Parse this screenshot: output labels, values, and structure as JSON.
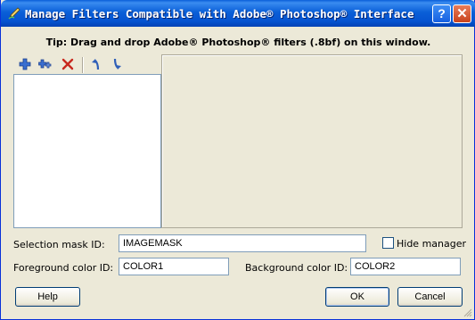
{
  "window": {
    "title": "Manage Filters Compatible with Adobe® Photoshop® Interface",
    "help_glyph": "?",
    "close_glyph": "✕"
  },
  "tip": "Tip: Drag and drop Adobe® Photoshop® filters (.8bf) on this window.",
  "toolbar": {
    "icons": [
      "add-filter-icon",
      "add-folder-icon",
      "delete-icon",
      "move-up-icon",
      "move-down-icon"
    ]
  },
  "form": {
    "selection_mask_label": "Selection mask ID:",
    "selection_mask_value": "IMAGEMASK",
    "hide_manager_label": "Hide manager",
    "hide_manager_checked": false,
    "foreground_label": "Foreground color ID:",
    "foreground_value": "COLOR1",
    "background_label": "Background color ID:",
    "background_value": "COLOR2"
  },
  "buttons": {
    "help": "Help",
    "ok": "OK",
    "cancel": "Cancel"
  },
  "colors": {
    "title_bar": "#0a5fd8",
    "face": "#ece9d8",
    "field_border": "#7f9db9"
  }
}
